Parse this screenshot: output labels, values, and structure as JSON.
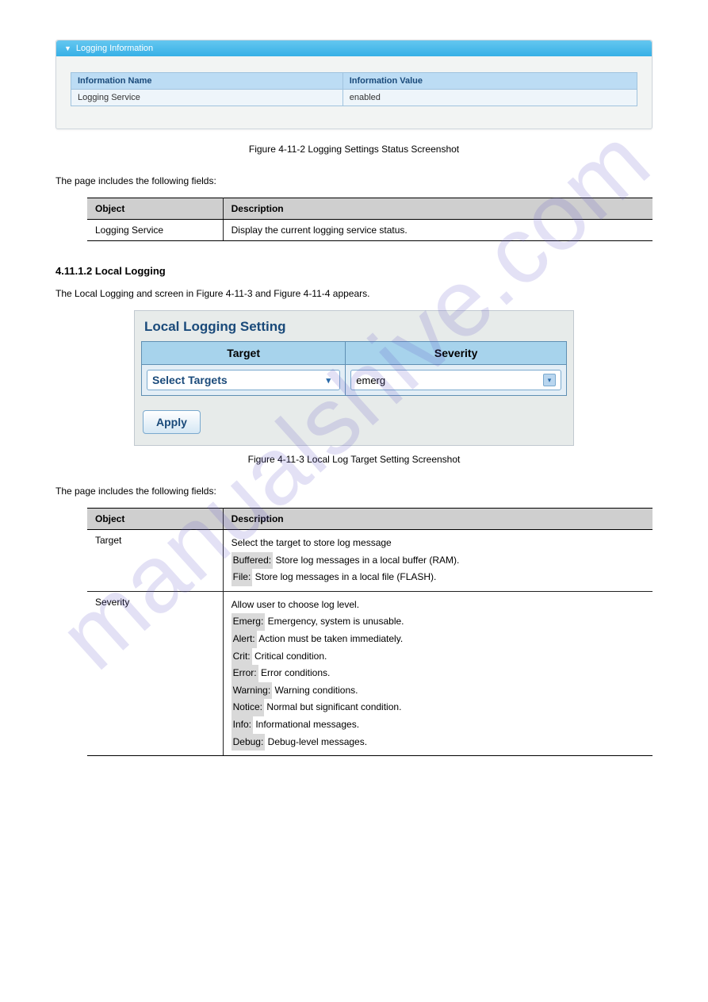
{
  "watermark": "manualshive.com",
  "logging_info_panel": {
    "title": "Logging Information",
    "columns": [
      "Information Name",
      "Information Value"
    ],
    "rows": [
      {
        "name": "Logging Service",
        "value": "enabled"
      }
    ]
  },
  "figure1_caption": "Figure 4-11-2 Logging Settings Status Screenshot",
  "table1_intro": "The page includes the following fields:",
  "spec_table1": {
    "headers": [
      "Object",
      "Description"
    ],
    "rows": [
      {
        "object": "Logging Service",
        "description": "Display the current logging service status."
      }
    ]
  },
  "section_heading": "4.11.1.2 Local Logging",
  "section_para": "The Local Logging and screen in Figure 4-11-3 and Figure 4-11-4 appears.",
  "local_panel": {
    "title": "Local Logging Setting",
    "columns": [
      "Target",
      "Severity"
    ],
    "target_value": "Select Targets",
    "severity_value": "emerg",
    "apply_label": "Apply"
  },
  "figure2_caption": "Figure 4-11-3 Local Log Target Setting Screenshot",
  "table2_intro": "The page includes the following fields:",
  "spec_table2": {
    "headers": [
      "Object",
      "Description"
    ],
    "rows": [
      {
        "object": "Target",
        "desc_intro": "Select the target to store log message",
        "items": [
          {
            "key": "Buffered:",
            "desc": "Store log messages in a local buffer (RAM)."
          },
          {
            "key": "File:",
            "desc": "Store log messages in a local file (FLASH)."
          }
        ]
      },
      {
        "object": "Severity",
        "desc_intro": "Allow user to choose log level.",
        "items": [
          {
            "key": "Emerg:",
            "desc": "Emergency, system is unusable."
          },
          {
            "key": "Alert:",
            "desc": "Action must be taken immediately."
          },
          {
            "key": "Crit:",
            "desc": "Critical condition."
          },
          {
            "key": "Error:",
            "desc": "Error conditions."
          },
          {
            "key": "Warning:",
            "desc": "Warning conditions."
          },
          {
            "key": "Notice:",
            "desc": "Normal but significant condition."
          },
          {
            "key": "Info:",
            "desc": "Informational messages."
          },
          {
            "key": "Debug:",
            "desc": "Debug-level messages."
          }
        ]
      }
    ]
  }
}
